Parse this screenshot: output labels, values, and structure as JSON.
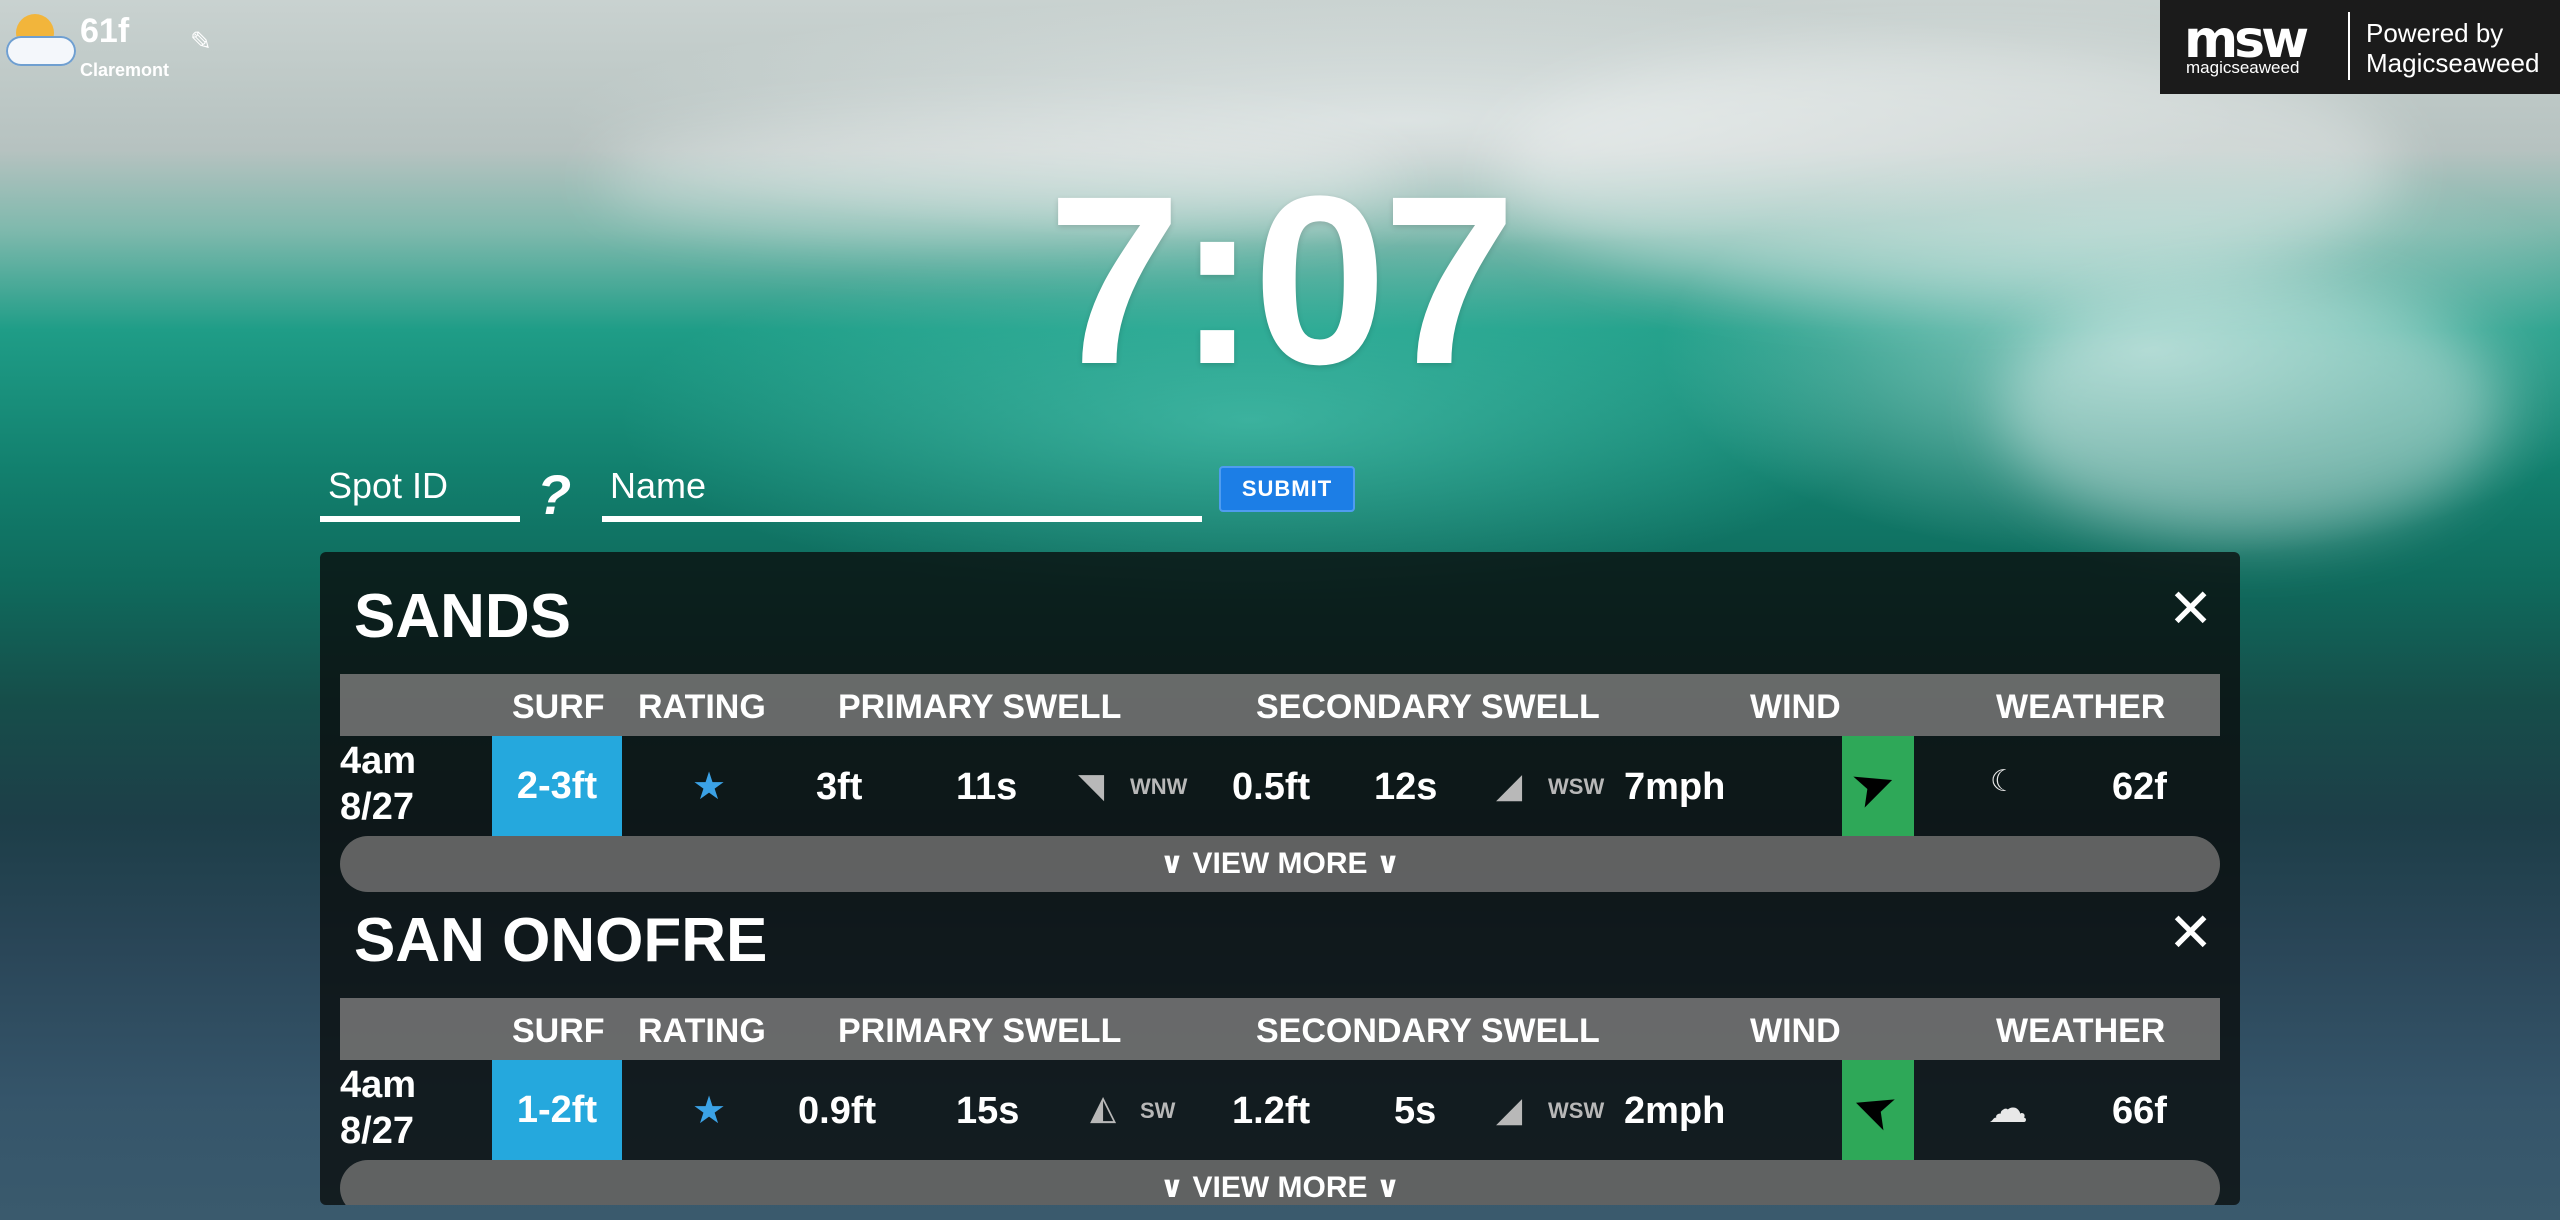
{
  "weather": {
    "temp": "61f",
    "city": "Claremont",
    "icon": "partly-cloudy-sun-icon"
  },
  "logo": {
    "mark": "msw",
    "sub": "magicseaweed",
    "powered": "Powered by",
    "brand": "Magicseaweed"
  },
  "clock": "7:07",
  "form": {
    "spot_id_placeholder": "Spot ID",
    "help": "?",
    "name_placeholder": "Name",
    "submit": "SUBMIT"
  },
  "headers": {
    "surf": "SURF",
    "rating": "RATING",
    "primary": "PRIMARY SWELL",
    "secondary": "SECONDARY SWELL",
    "wind": "WIND",
    "weather": "WEATHER"
  },
  "spots": [
    {
      "name": "SANDS",
      "time": "4am",
      "date": "8/27",
      "surf": "2-3ft",
      "rating_stars": 1,
      "primary_height": "3ft",
      "primary_period": "11s",
      "primary_dir": "WNW",
      "secondary_height": "0.5ft",
      "secondary_period": "12s",
      "secondary_dir": "WSW",
      "wind": "7mph",
      "wind_color": "#2ea858",
      "weather_icon": "moon-icon",
      "temp": "62f",
      "view_more": "∨ VIEW MORE ∨"
    },
    {
      "name": "SAN ONOFRE",
      "time": "4am",
      "date": "8/27",
      "surf": "1-2ft",
      "rating_stars": 1,
      "primary_height": "0.9ft",
      "primary_period": "15s",
      "primary_dir": "SW",
      "secondary_height": "1.2ft",
      "secondary_period": "5s",
      "secondary_dir": "WSW",
      "wind": "2mph",
      "wind_color": "#2ea858",
      "weather_icon": "cloud-icon",
      "temp": "66f",
      "view_more": "∨ VIEW MORE ∨"
    }
  ],
  "colors": {
    "surf_cell": "#25a8dd",
    "wind_cell": "#2ea858",
    "submit": "#1c7ee6",
    "star": "#3ba2e6"
  }
}
